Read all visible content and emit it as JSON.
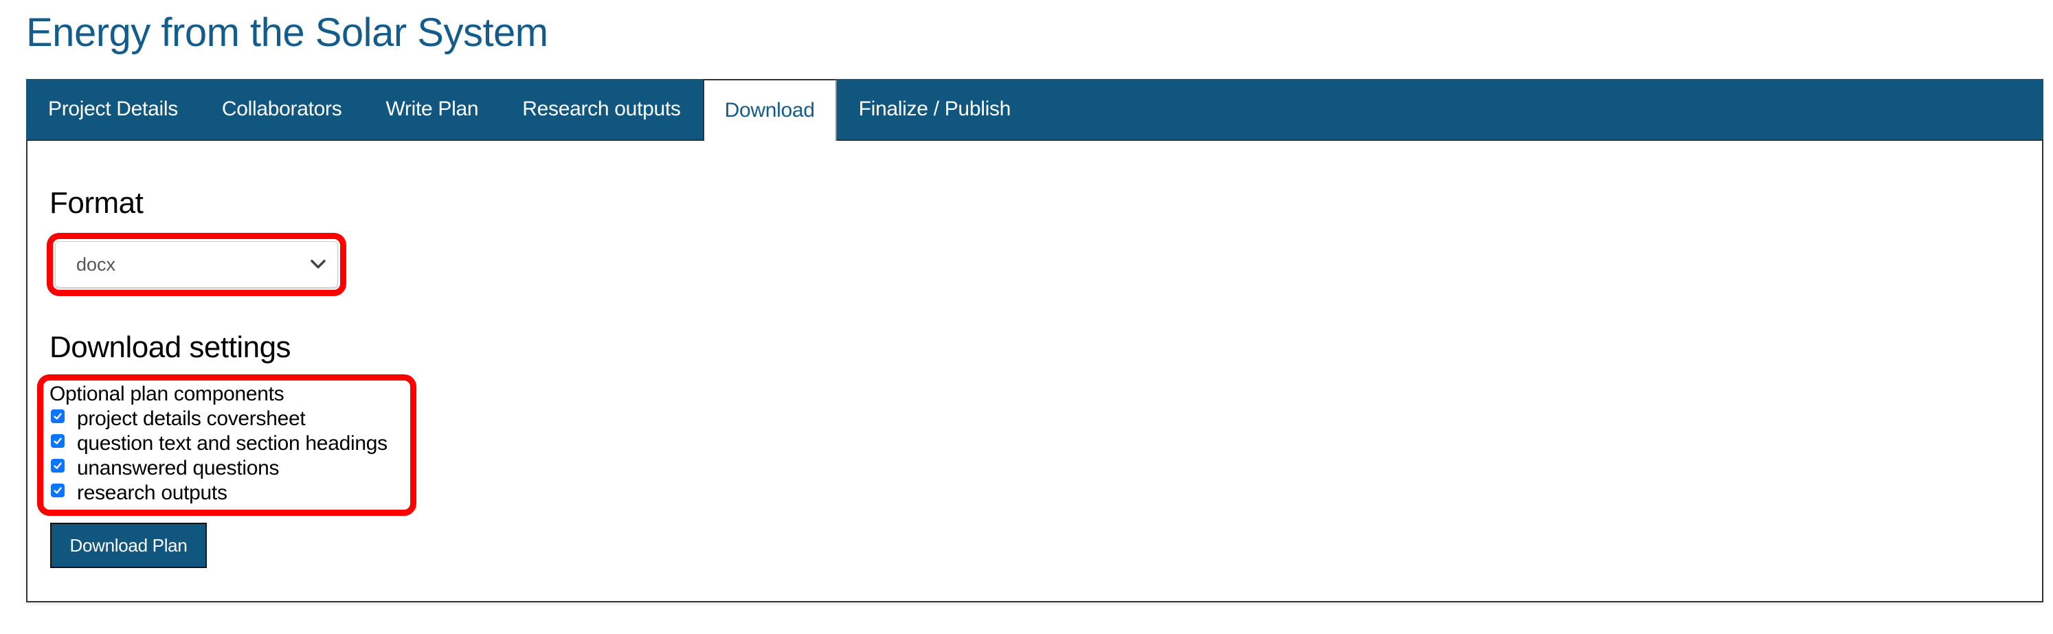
{
  "page": {
    "title": "Energy from the Solar System"
  },
  "tabs": [
    {
      "label": "Project Details",
      "active": false
    },
    {
      "label": "Collaborators",
      "active": false
    },
    {
      "label": "Write Plan",
      "active": false
    },
    {
      "label": "Research outputs",
      "active": false
    },
    {
      "label": "Download",
      "active": true
    },
    {
      "label": "Finalize / Publish",
      "active": false
    }
  ],
  "format": {
    "heading": "Format",
    "selected": "docx",
    "chevron_icon": "chevron-down-icon"
  },
  "settings": {
    "heading": "Download settings",
    "legend": "Optional plan components",
    "options": [
      {
        "label": "project details coversheet",
        "checked": true
      },
      {
        "label": "question text and section headings",
        "checked": true
      },
      {
        "label": "unanswered questions",
        "checked": true
      },
      {
        "label": "research outputs",
        "checked": true
      }
    ]
  },
  "actions": {
    "download_label": "Download Plan"
  },
  "colors": {
    "brand": "#10567f",
    "title": "#135c8c",
    "highlight": "#ff0000",
    "checkbox": "#0a75ff"
  }
}
